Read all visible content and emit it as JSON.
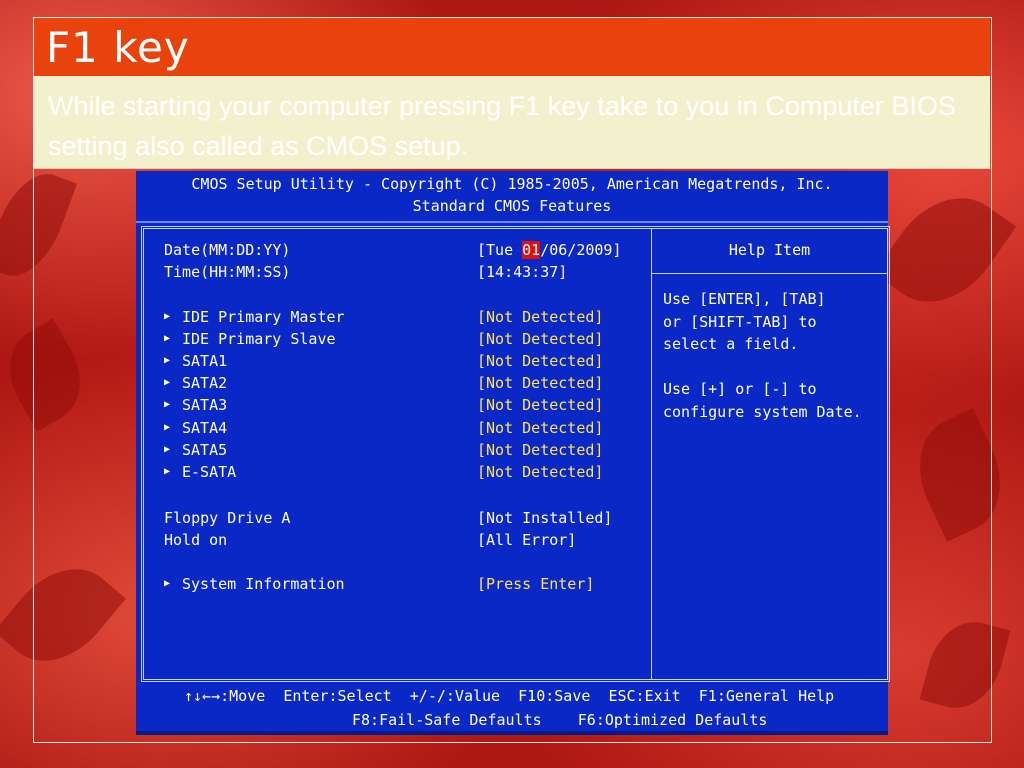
{
  "slide": {
    "title": "F1 key",
    "subtitle": "While starting your computer pressing F1 key take to you in Computer BIOS setting also called as CMOS setup."
  },
  "bios": {
    "header_line1": "CMOS Setup Utility - Copyright (C) 1985-2005, American Megatrends, Inc.",
    "header_line2": "Standard CMOS Features",
    "date": {
      "label": "Date(MM:DD:YY)",
      "prefix": "[Tue ",
      "selected": "01",
      "suffix": "/06/2009]"
    },
    "time": {
      "label": "Time(HH:MM:SS)",
      "value": "[14:43:37]"
    },
    "devices": [
      {
        "label": "IDE Primary Master",
        "value": "[Not Detected]"
      },
      {
        "label": "IDE Primary Slave",
        "value": "[Not Detected]"
      },
      {
        "label": "SATA1",
        "value": "[Not Detected]"
      },
      {
        "label": "SATA2",
        "value": "[Not Detected]"
      },
      {
        "label": "SATA3",
        "value": "[Not Detected]"
      },
      {
        "label": "SATA4",
        "value": "[Not Detected]"
      },
      {
        "label": "SATA5",
        "value": "[Not Detected]"
      },
      {
        "label": "E-SATA",
        "value": "[Not Detected]"
      }
    ],
    "floppy": {
      "label": "Floppy Drive A",
      "value": "[Not Installed]"
    },
    "hold_on": {
      "label": "Hold on",
      "value": "[All Error]"
    },
    "system_info": {
      "label": "System Information",
      "value": "[Press Enter]"
    },
    "help": {
      "title": "Help Item",
      "lines": [
        "Use [ENTER], [TAB]",
        "or [SHIFT-TAB] to",
        "select a field.",
        "",
        "Use [+] or [-] to",
        "configure system Date."
      ]
    },
    "footer_line1": "↑↓←→:Move  Enter:Select  +/-/:Value  F10:Save  ESC:Exit  F1:General Help",
    "footer_line2": "F8:Fail-Safe Defaults    F6:Optimized Defaults"
  },
  "colors": {
    "title_bar": "#e8430c",
    "subtitle_bg": "#f3f1cd",
    "bios_bg": "#0a28c6",
    "bios_value_yellow": "#ffe25a",
    "bios_selected": "#e01010"
  },
  "icons": {
    "submenu": "triangle-right-icon"
  }
}
